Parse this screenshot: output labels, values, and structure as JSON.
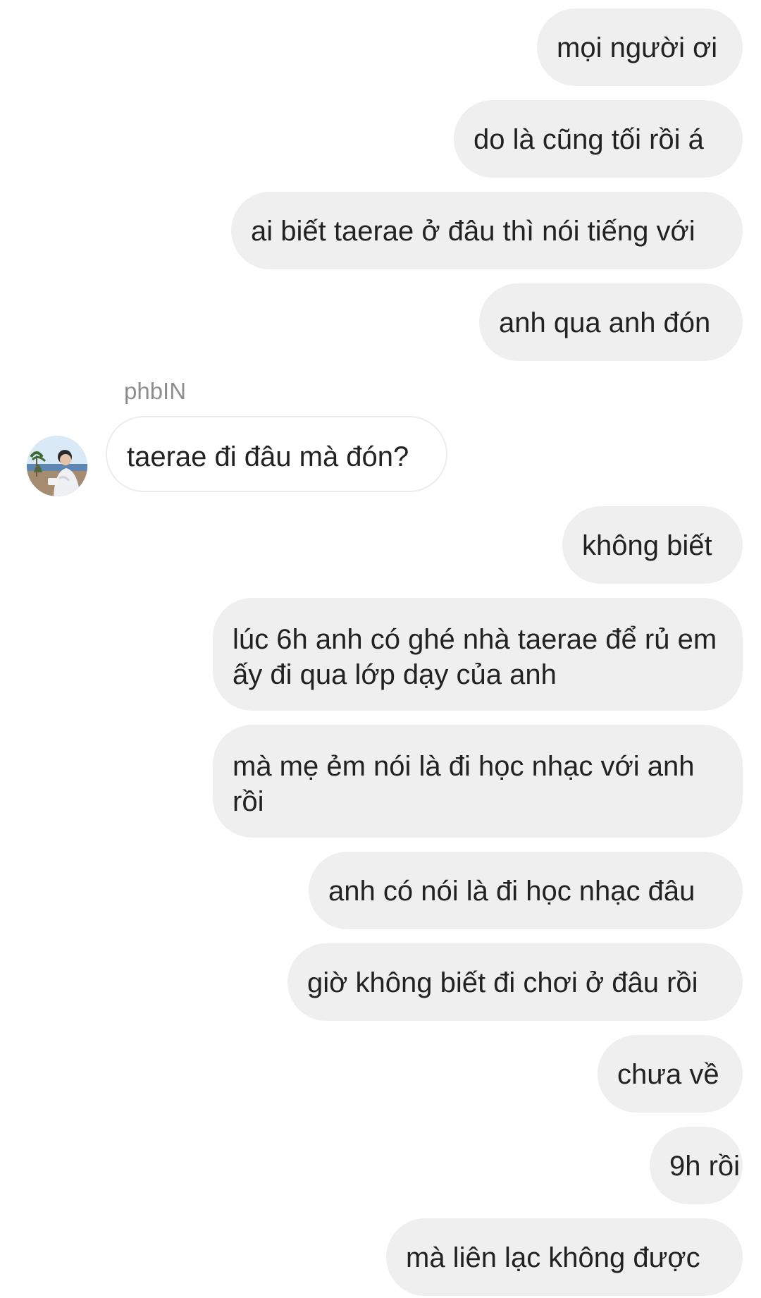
{
  "chat": {
    "sender_name": "phbIN",
    "messages": [
      {
        "from": "me",
        "text": "mọi người ơi"
      },
      {
        "from": "me",
        "text": "do là cũng tối rồi á"
      },
      {
        "from": "me",
        "text": "ai biết taerae ở đâu thì nói tiếng với"
      },
      {
        "from": "me",
        "text": "anh qua anh đón"
      },
      {
        "from": "phbIN",
        "text": "taerae đi đâu mà đón?"
      },
      {
        "from": "me",
        "text": "không biết"
      },
      {
        "from": "me",
        "text": "lúc 6h anh có ghé nhà taerae để rủ em ấy đi qua lớp dạy của anh"
      },
      {
        "from": "me",
        "text": "mà mẹ ẻm nói là đi học nhạc với anh rồi"
      },
      {
        "from": "me",
        "text": "anh có nói là đi học nhạc đâu"
      },
      {
        "from": "me",
        "text": "giờ không biết đi chơi ở đâu rồi"
      },
      {
        "from": "me",
        "text": "chưa về"
      },
      {
        "from": "me",
        "text": "9h rồi"
      },
      {
        "from": "me",
        "text": "mà liên lạc không được"
      }
    ]
  },
  "icons": {
    "avatar": "profile-photo-avatar"
  }
}
